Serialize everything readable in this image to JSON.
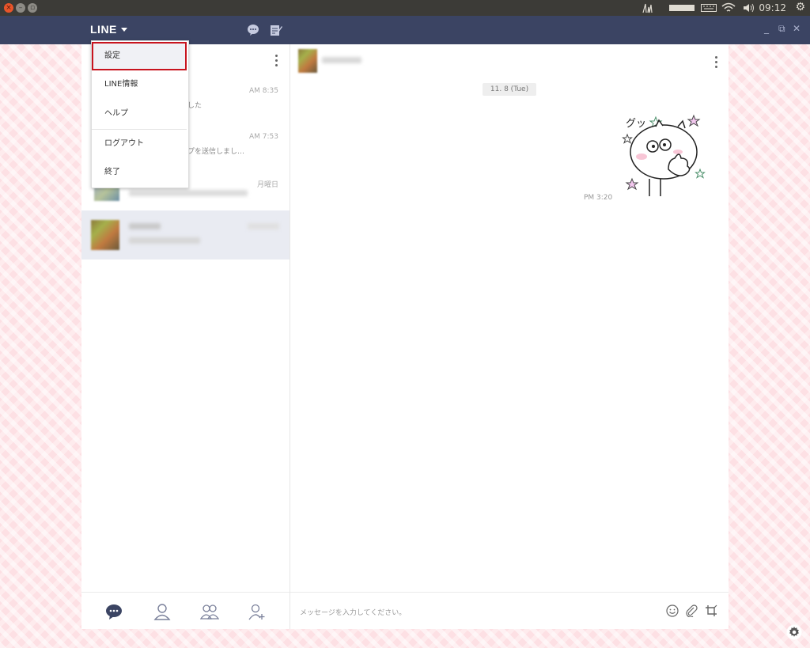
{
  "system_bar": {
    "clock": "09:12"
  },
  "header": {
    "logo": "LINE"
  },
  "menu": {
    "items": [
      {
        "label": "設定"
      },
      {
        "label": "LINE情報"
      },
      {
        "label": "ヘルプ"
      },
      {
        "label": "ログアウト"
      },
      {
        "label": "終了"
      }
    ]
  },
  "chat_list": [
    {
      "time": "AM 8:35",
      "preview": "した"
    },
    {
      "time": "AM 7:53",
      "preview": "プを送信しまし…"
    },
    {
      "time": "月曜日",
      "preview": ""
    },
    {
      "time": "",
      "preview": ""
    }
  ],
  "conversation": {
    "date": "11. 8 (Tue)",
    "message_time": "PM 3:20",
    "sticker_text": "グッ"
  },
  "input": {
    "placeholder": "メッセージを入力してください。"
  },
  "colors": {
    "header_bg": "#3b4463",
    "menu_highlight_border": "#c8141e",
    "background_pink": "#fde0e4"
  },
  "icons": {
    "chat_tab": "speech-bubble-icon",
    "friends_tab": "person-icon",
    "groups_tab": "people-icon",
    "add_friend_tab": "add-person-icon",
    "emoji": "smile-icon",
    "attach": "paperclip-icon",
    "capture": "crop-icon"
  }
}
